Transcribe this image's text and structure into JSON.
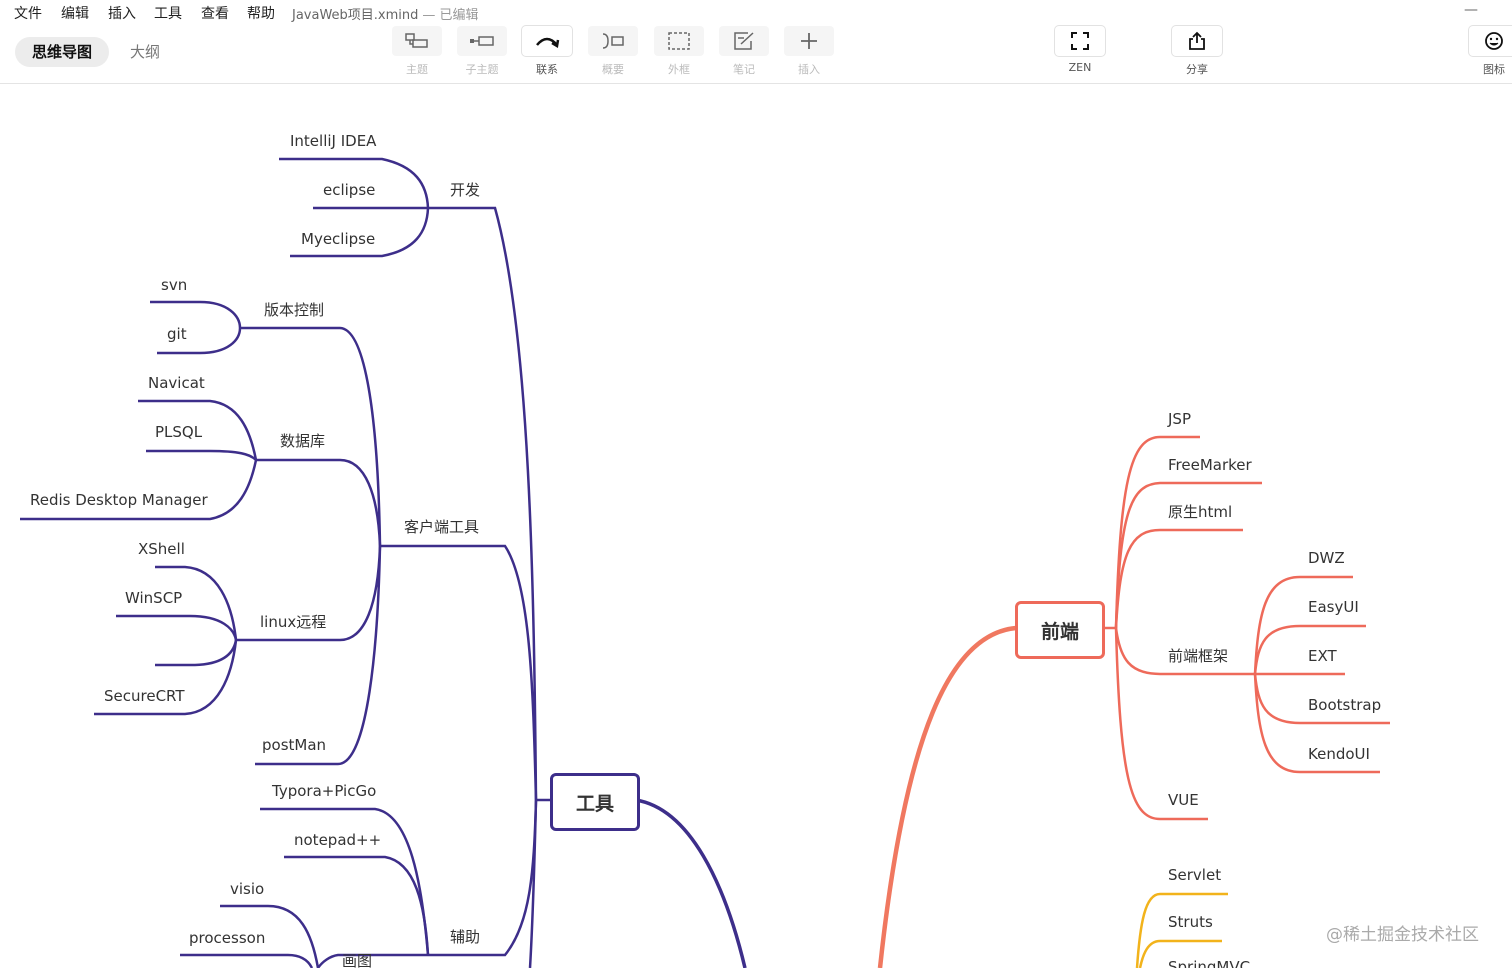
{
  "menu": {
    "file": "文件",
    "edit": "编辑",
    "insert": "插入",
    "tools": "工具",
    "view": "查看",
    "help": "帮助"
  },
  "document": {
    "name": "JavaWeb项目.xmind",
    "status": "— 已编辑"
  },
  "window": {
    "minimize": "—"
  },
  "view_tabs": {
    "mindmap": "思维导图",
    "outline": "大纲"
  },
  "toolbar": {
    "topic": "主题",
    "subtopic": "子主题",
    "relationship": "联系",
    "summary": "概要",
    "boundary": "外框",
    "note": "笔记",
    "insert": "插入",
    "zen": "ZEN",
    "share": "分享",
    "icon": "图标"
  },
  "colors": {
    "purple": "#3d2e8a",
    "salmon": "#ee6a5a",
    "orange": "#f07860",
    "gold": "#f2b31b"
  },
  "mindmap": {
    "tools": {
      "title": "工具",
      "dev": {
        "label": "开发",
        "items": [
          "IntelliJ IDEA",
          "eclipse",
          "Myeclipse"
        ]
      },
      "client": {
        "label": "客户端工具",
        "vcs": {
          "label": "版本控制",
          "items": [
            "svn",
            "git"
          ]
        },
        "db": {
          "label": "数据库",
          "items": [
            "Navicat",
            "PLSQL",
            "Redis Desktop Manager"
          ]
        },
        "linux": {
          "label": "linux远程",
          "items": [
            "XShell",
            "WinSCP",
            "SecureCRT"
          ]
        },
        "postman": "postMan"
      },
      "aux": {
        "label": "辅助",
        "items": [
          "Typora+PicGo",
          "notepad++"
        ],
        "draw": {
          "label": "画图",
          "items": [
            "visio",
            "processon"
          ]
        }
      }
    },
    "frontend": {
      "title": "前端",
      "items": [
        "JSP",
        "FreeMarker",
        "原生html"
      ],
      "frameworks": {
        "label": "前端框架",
        "items": [
          "DWZ",
          "EasyUI",
          "EXT",
          "Bootstrap",
          "KendoUI"
        ]
      },
      "vue": "VUE"
    },
    "backend": {
      "items": [
        "Servlet",
        "Struts",
        "SpringMVC"
      ]
    }
  },
  "watermark": "@稀土掘金技术社区"
}
